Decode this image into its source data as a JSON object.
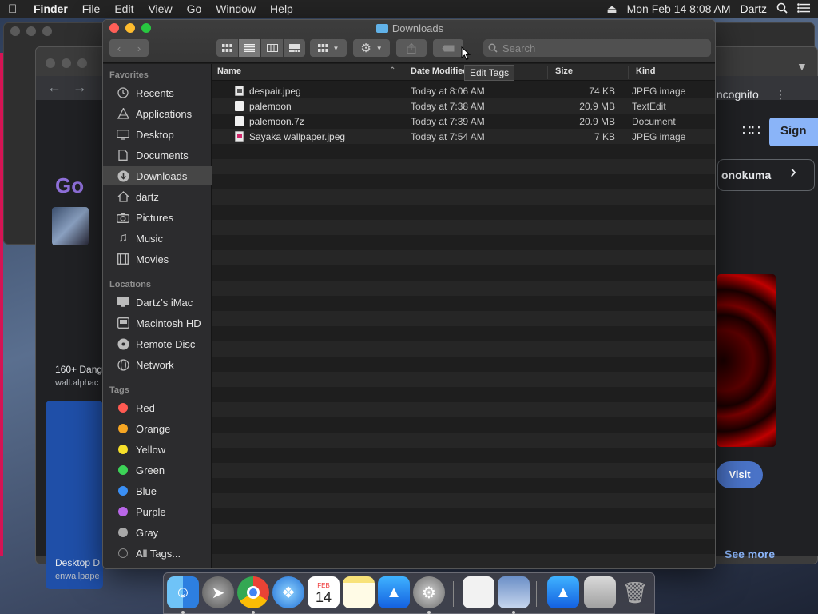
{
  "menubar": {
    "app_name": "Finder",
    "items": [
      "File",
      "Edit",
      "View",
      "Go",
      "Window",
      "Help"
    ],
    "clock": "Mon Feb 14  8:08 AM",
    "user": "Dartz"
  },
  "background_chrome": {
    "incognito_label": "Incognito",
    "sign_in_label": "Sign",
    "chip_label": "onokuma",
    "visit_label": "Visit",
    "see_more_label": "See more",
    "left_text_1": "160+ Dang",
    "left_text_2": "wall.alphac",
    "left_text_3": "Desktop D",
    "left_text_4": "enwallpape",
    "logo_text": "Go"
  },
  "finder": {
    "title": "Downloads",
    "search_placeholder": "Search",
    "sidebar": {
      "favorites_header": "Favorites",
      "favorites": [
        {
          "label": "Recents",
          "icon": "clock-icon"
        },
        {
          "label": "Applications",
          "icon": "applications-icon"
        },
        {
          "label": "Desktop",
          "icon": "desktop-icon"
        },
        {
          "label": "Documents",
          "icon": "document-icon"
        },
        {
          "label": "Downloads",
          "icon": "download-icon",
          "selected": true
        },
        {
          "label": "dartz",
          "icon": "home-icon"
        },
        {
          "label": "Pictures",
          "icon": "camera-icon"
        },
        {
          "label": "Music",
          "icon": "music-note-icon"
        },
        {
          "label": "Movies",
          "icon": "film-icon"
        }
      ],
      "locations_header": "Locations",
      "locations": [
        {
          "label": "Dartz’s iMac",
          "icon": "imac-icon"
        },
        {
          "label": "Macintosh HD",
          "icon": "hard-drive-icon"
        },
        {
          "label": "Remote Disc",
          "icon": "disc-icon"
        },
        {
          "label": "Network",
          "icon": "globe-icon"
        }
      ],
      "tags_header": "Tags",
      "tags": [
        {
          "label": "Red",
          "color": "#ff5a52"
        },
        {
          "label": "Orange",
          "color": "#f6a623"
        },
        {
          "label": "Yellow",
          "color": "#f7e02a"
        },
        {
          "label": "Green",
          "color": "#3cd357"
        },
        {
          "label": "Blue",
          "color": "#3a8ff5"
        },
        {
          "label": "Purple",
          "color": "#b966e8"
        },
        {
          "label": "Gray",
          "color": "#a8a8a8"
        }
      ],
      "all_tags_label": "All Tags..."
    },
    "columns": {
      "name": "Name",
      "date": "Date Modified",
      "size": "Size",
      "kind": "Kind"
    },
    "files": [
      {
        "name": "despair.jpeg",
        "date": "Today at 8:06 AM",
        "size": "74 KB",
        "kind": "JPEG image",
        "icon": "image-file-icon"
      },
      {
        "name": "palemoon",
        "date": "Today at 7:38 AM",
        "size": "20.9 MB",
        "kind": "TextEdit",
        "icon": "text-file-icon"
      },
      {
        "name": "palemoon.7z",
        "date": "Today at 7:39 AM",
        "size": "20.9 MB",
        "kind": "Document",
        "icon": "document-file-icon"
      },
      {
        "name": "Sayaka wallpaper.jpeg",
        "date": "Today at 7:54 AM",
        "size": "7 KB",
        "kind": "JPEG image",
        "icon": "image-file-icon"
      }
    ],
    "tooltip": "Edit Tags"
  },
  "dock": {
    "calendar_day": "14",
    "calendar_month": "FEB"
  }
}
